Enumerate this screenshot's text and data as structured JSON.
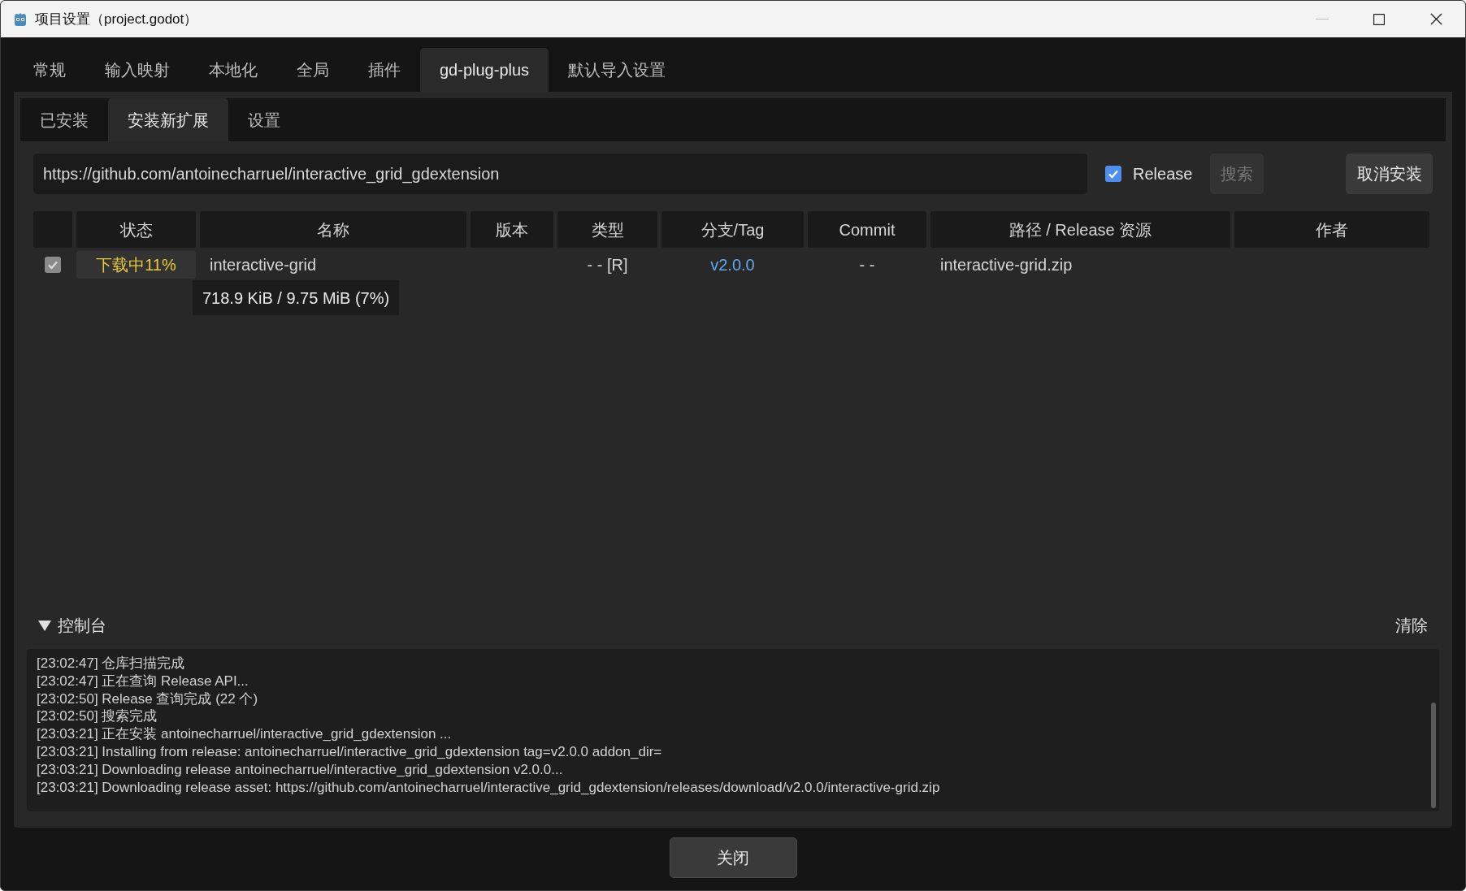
{
  "window": {
    "title": "项目设置（project.godot）"
  },
  "tabs": [
    {
      "label": "常规",
      "selected": false
    },
    {
      "label": "输入映射",
      "selected": false
    },
    {
      "label": "本地化",
      "selected": false
    },
    {
      "label": "全局",
      "selected": false
    },
    {
      "label": "插件",
      "selected": false
    },
    {
      "label": "gd-plug-plus",
      "selected": true
    },
    {
      "label": "默认导入设置",
      "selected": false
    }
  ],
  "subtabs": [
    {
      "label": "已安装",
      "selected": false
    },
    {
      "label": "安装新扩展",
      "selected": true
    },
    {
      "label": "设置",
      "selected": false
    }
  ],
  "url_field": {
    "value": "https://github.com/antoinecharruel/interactive_grid_gdextension"
  },
  "release_checkbox": {
    "label": "Release",
    "checked": true
  },
  "search_button": {
    "label": "搜索",
    "disabled": true
  },
  "cancel_button": {
    "label": "取消安装"
  },
  "table": {
    "columns": [
      "",
      "状态",
      "名称",
      "版本",
      "类型",
      "分支/Tag",
      "Commit",
      "路径 / Release 资源",
      "作者"
    ],
    "rows": [
      {
        "checked": true,
        "status": "下载中11%",
        "name": "interactive-grid",
        "type": "- - [R]",
        "branch": "v2.0.0",
        "commit": "- -",
        "path": "interactive-grid.zip"
      }
    ]
  },
  "tooltip": "718.9 KiB / 9.75 MiB (7%)",
  "console": {
    "title": "控制台",
    "expanded": true,
    "clear": "清除",
    "lines": [
      "[23:02:47] 仓库扫描完成",
      "[23:02:47] 正在查询 Release API...",
      "[23:02:50] Release 查询完成 (22 个)",
      "[23:02:50] 搜索完成",
      "[23:03:21] 正在安装 antoinecharruel/interactive_grid_gdextension ...",
      "[23:03:21] Installing from release: antoinecharruel/interactive_grid_gdextension tag=v2.0.0 addon_dir=",
      "[23:03:21] Downloading release antoinecharruel/interactive_grid_gdextension v2.0.0...",
      "[23:03:21] Downloading release asset: https://github.com/antoinecharruel/interactive_grid_gdextension/releases/download/v2.0.0/interactive-grid.zip"
    ]
  },
  "close_button": "关闭"
}
